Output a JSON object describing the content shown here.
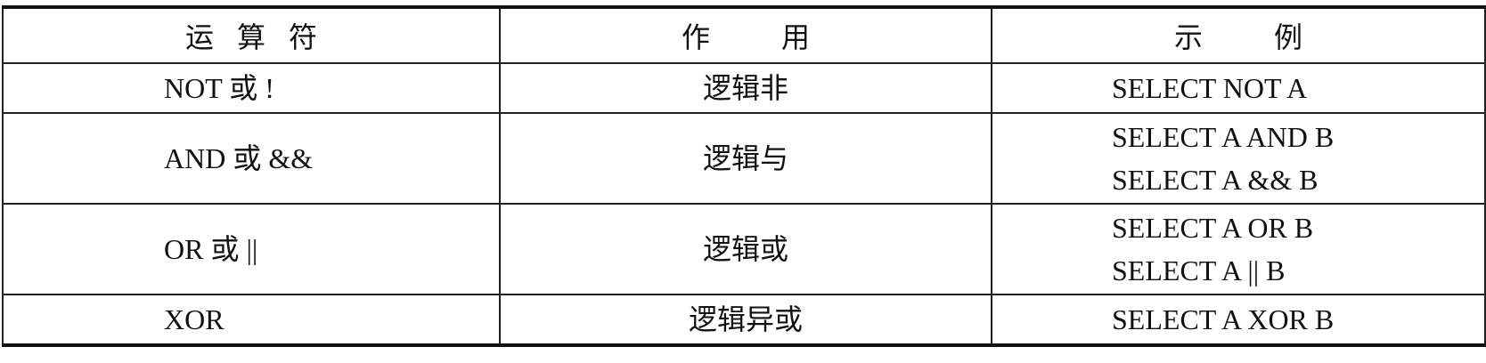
{
  "table": {
    "headers": {
      "operator": "运算符",
      "function": "作用",
      "example": "示例"
    },
    "rows": [
      {
        "operator": "NOT 或 !",
        "function": "逻辑非",
        "examples": [
          "SELECT NOT A"
        ]
      },
      {
        "operator": "AND 或 &&",
        "function": "逻辑与",
        "examples": [
          "SELECT A AND B",
          "SELECT A && B"
        ]
      },
      {
        "operator": "OR 或 ||",
        "function": "逻辑或",
        "examples": [
          "SELECT A OR B",
          "SELECT A || B"
        ]
      },
      {
        "operator": "XOR",
        "function": "逻辑异或",
        "examples": [
          "SELECT A XOR B"
        ]
      }
    ]
  }
}
